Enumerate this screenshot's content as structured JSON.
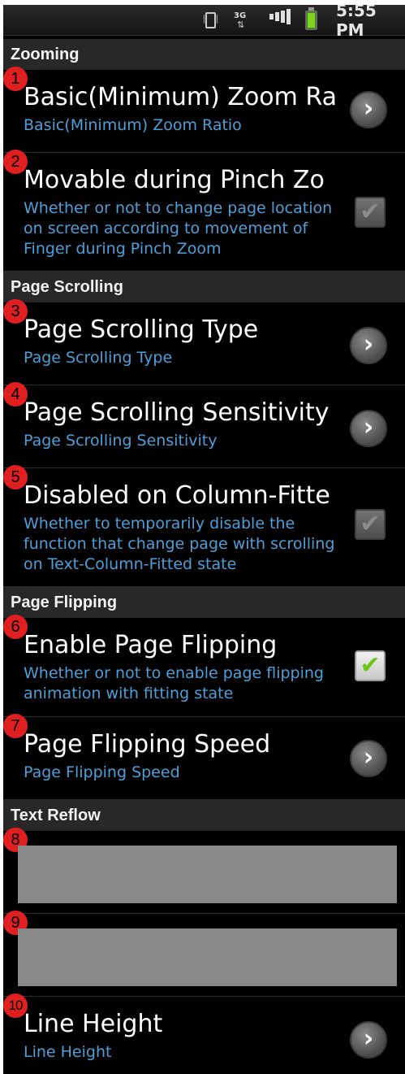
{
  "status_bar": {
    "time": "5:55 PM",
    "network": "3G",
    "icons": [
      "vibrate-icon",
      "3g-data-icon",
      "signal-icon",
      "battery-icon"
    ]
  },
  "sections": [
    {
      "header": "Zooming",
      "items": [
        {
          "badge": "1",
          "title": "Basic(Minimum) Zoom Ra",
          "summary": "Basic(Minimum) Zoom Ratio",
          "control": "chevron"
        },
        {
          "badge": "2",
          "title": "Movable during Pinch Zo",
          "summary": "Whether or not to change page location on screen according to movement of Finger during Pinch Zoom",
          "control": "checkbox",
          "checked": true,
          "enabled": false
        }
      ]
    },
    {
      "header": "Page Scrolling",
      "items": [
        {
          "badge": "3",
          "title": "Page Scrolling Type",
          "summary": "Page Scrolling Type",
          "control": "chevron"
        },
        {
          "badge": "4",
          "title": "Page Scrolling Sensitivity",
          "summary": "Page Scrolling Sensitivity",
          "control": "chevron"
        },
        {
          "badge": "5",
          "title": "Disabled on Column-Fitte",
          "summary": "Whether to temporarily disable the function that change page with scrolling on Text-Column-Fitted state",
          "control": "checkbox",
          "checked": true,
          "enabled": false
        }
      ]
    },
    {
      "header": "Page Flipping",
      "items": [
        {
          "badge": "6",
          "title": "Enable Page Flipping",
          "summary": "Whether or not to enable page flipping animation with fitting state",
          "control": "checkbox",
          "checked": true,
          "enabled": true
        },
        {
          "badge": "7",
          "title": "Page Flipping Speed",
          "summary": "Page Flipping Speed",
          "control": "chevron"
        }
      ]
    },
    {
      "header": "Text Reflow",
      "items": [
        {
          "badge": "8",
          "redacted": true
        },
        {
          "badge": "9",
          "redacted": true
        },
        {
          "badge": "10",
          "title": "Line Height",
          "summary": "Line Height",
          "control": "chevron"
        }
      ]
    }
  ],
  "colors": {
    "background": "#000000",
    "section_header": "#282828",
    "summary_text": "#4e9fd8",
    "badge": "#e02020",
    "check_green": "#6cc61a",
    "redacted_block": "#888888"
  }
}
